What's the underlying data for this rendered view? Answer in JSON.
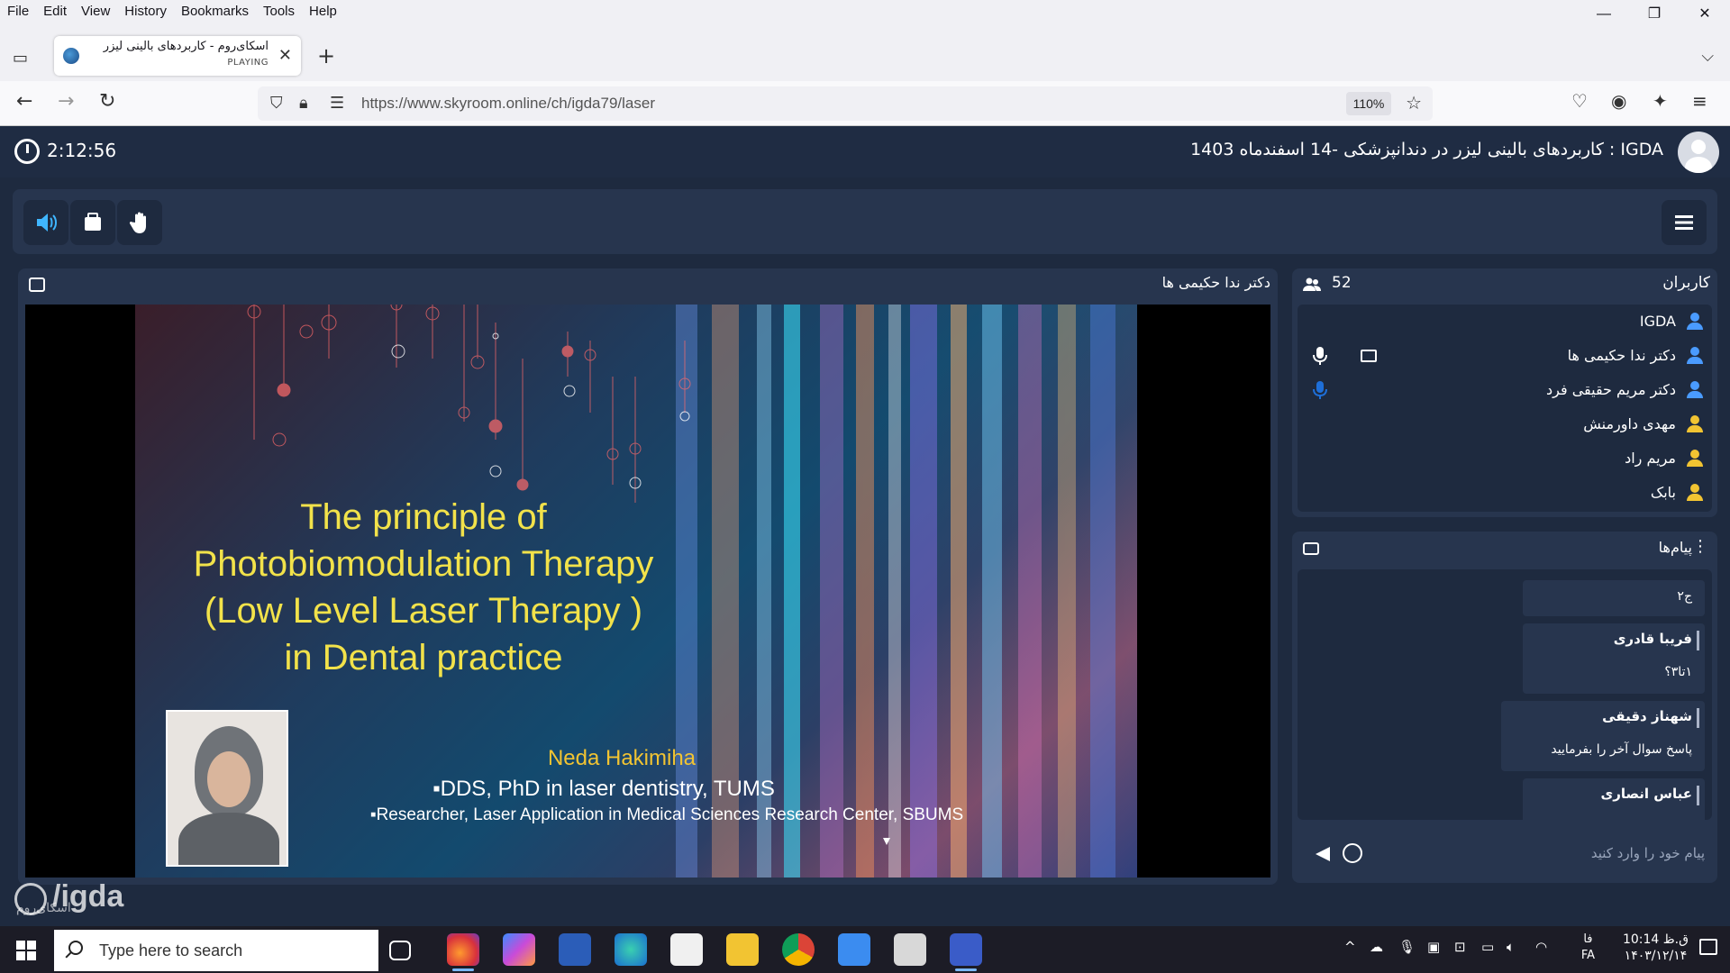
{
  "browser": {
    "menu": [
      "File",
      "Edit",
      "View",
      "History",
      "Bookmarks",
      "Tools",
      "Help"
    ],
    "window_controls": {
      "minimize": "—",
      "restore": "❐",
      "close": "✕"
    },
    "tab": {
      "title": "اسکای‌روم - کاربردهای بالینی لیزر",
      "status": "PLAYING",
      "close": "✕"
    },
    "new_tab": "+",
    "url": "https://www.skyroom.online/ch/igda79/laser",
    "zoom": "110%"
  },
  "app": {
    "elapsed_time": "2:12:56",
    "meeting_title": "IGDA : کاربردهای بالینی لیزر در دندانپزشکی -14 اسفندماه 1403"
  },
  "presentation": {
    "presenter": "دکتر ندا حکیمی ها",
    "slide": {
      "title_lines": [
        "The principle of",
        "Photobiomodulation Therapy",
        "(Low Level Laser Therapy )",
        "in Dental practice"
      ],
      "speaker": "Neda Hakimiha",
      "degree": "▪DDS, PhD  in laser  dentistry, TUMS",
      "affiliation": "▪Researcher, Laser Application in Medical Sciences Research Center, SBUMS"
    }
  },
  "users": {
    "header": "کاربران",
    "count": "52",
    "list": [
      {
        "name": "IGDA",
        "color": "#4a9bff"
      },
      {
        "name": "دکتر ندا حکیمی ها",
        "color": "#4a9bff"
      },
      {
        "name": "دکتر مریم حقیقی فرد",
        "color": "#4a9bff"
      },
      {
        "name": "مهدی داورمنش",
        "color": "#f2c432"
      },
      {
        "name": "مریم راد",
        "color": "#f2c432"
      },
      {
        "name": "بابک",
        "color": "#f2c432"
      }
    ]
  },
  "messages": {
    "header": "پیام‌ها",
    "items": [
      {
        "name": "",
        "text": "ج۲"
      },
      {
        "name": "فریبا قادری",
        "text": "۱تا۳؟"
      },
      {
        "name": "شهناز دقیقی",
        "text": "پاسخ سوال آخر را بفرمایید"
      },
      {
        "name": "عباس انصاری",
        "text": ""
      }
    ],
    "placeholder": "پیام خود را وارد کنید"
  },
  "watermark": {
    "handle": "/igda",
    "brand": "اسکای‌روم"
  },
  "taskbar": {
    "search_placeholder": "Type here to search",
    "lang_top": "فا",
    "lang_bottom": "FA",
    "time": "10:14 ق.ظ",
    "date": "۱۴۰۳/۱۲/۱۴"
  },
  "colors": {
    "accent": "#1e6fd9",
    "panel": "#27354e",
    "background": "#1e2a3f",
    "slide_title": "#f2e24a"
  }
}
